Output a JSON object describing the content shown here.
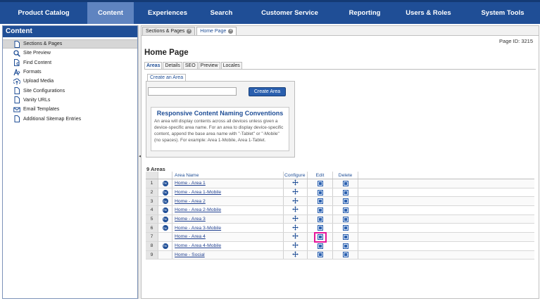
{
  "nav": {
    "items": [
      {
        "label": "Product Catalog",
        "active": false
      },
      {
        "label": "Content",
        "active": true
      },
      {
        "label": "Experiences",
        "active": false
      },
      {
        "label": "Search",
        "active": false
      },
      {
        "label": "Customer Service",
        "active": false
      },
      {
        "label": "Reporting",
        "active": false
      },
      {
        "label": "Users & Roles",
        "active": false
      },
      {
        "label": "System Tools",
        "active": false
      }
    ]
  },
  "sidebar": {
    "title": "Content",
    "items": [
      {
        "label": "Sections & Pages",
        "icon": "page-icon",
        "selected": true
      },
      {
        "label": "Site Preview",
        "icon": "magnifier-icon",
        "selected": false
      },
      {
        "label": "Find Content",
        "icon": "find-page-icon",
        "selected": false
      },
      {
        "label": "Formats",
        "icon": "formats-icon",
        "selected": false
      },
      {
        "label": "Upload Media",
        "icon": "upload-icon",
        "selected": false
      },
      {
        "label": "Site Configurations",
        "icon": "page-icon",
        "selected": false
      },
      {
        "label": "Vanity URLs",
        "icon": "page-icon",
        "selected": false
      },
      {
        "label": "Email Templates",
        "icon": "envelope-icon",
        "selected": false
      },
      {
        "label": "Additional Sitemap Entries",
        "icon": "page-icon",
        "selected": false
      }
    ]
  },
  "tabs": [
    {
      "label": "Sections & Pages",
      "active": false
    },
    {
      "label": "Home Page",
      "active": true
    }
  ],
  "page": {
    "id_text": "Page ID: 3215",
    "title": "Home Page",
    "subtabs": [
      {
        "label": "Areas",
        "active": true
      },
      {
        "label": "Details",
        "active": false
      },
      {
        "label": "SEO",
        "active": false
      },
      {
        "label": "Preview",
        "active": false
      },
      {
        "label": "Locales",
        "active": false
      }
    ]
  },
  "create_area": {
    "legend": "Create an Area",
    "input_value": "",
    "button_label": "Create Area",
    "naming_title": "Responsive Content Naming Conventions",
    "naming_text": "An area will display contents across all devices unless given a device-specific area name. For an area to display device-specific content, append the base area name with \"-Tablet\" or \"-Mobile\" (no spaces). For example: Area 1-Mobile, Area 1-Tablet."
  },
  "areas": {
    "count_label": "9 Areas",
    "headers": {
      "name": "Area Name",
      "configure": "Configure",
      "edit": "Edit",
      "delete": "Delete"
    },
    "rows": [
      {
        "num": "1",
        "name": "Home - Area 1",
        "has_badge": true
      },
      {
        "num": "2",
        "name": "Home - Area 1-Mobile",
        "has_badge": true
      },
      {
        "num": "3",
        "name": "Home - Area 2",
        "has_badge": true
      },
      {
        "num": "4",
        "name": "Home - Area 2-Mobile",
        "has_badge": true
      },
      {
        "num": "5",
        "name": "Home - Area 3",
        "has_badge": true
      },
      {
        "num": "6",
        "name": "Home - Area 3-Mobile",
        "has_badge": true
      },
      {
        "num": "7",
        "name": "Home - Area 4",
        "has_badge": false
      },
      {
        "num": "8",
        "name": "Home - Area 4-Mobile",
        "has_badge": true
      },
      {
        "num": "9",
        "name": "Home - Social",
        "has_badge": false
      }
    ],
    "highlighted_row": 7,
    "highlight_color": "#e6169a"
  },
  "colors": {
    "nav_bg": "#1f4e96",
    "nav_active": "#5f84c0",
    "link": "#1f3f8f"
  }
}
